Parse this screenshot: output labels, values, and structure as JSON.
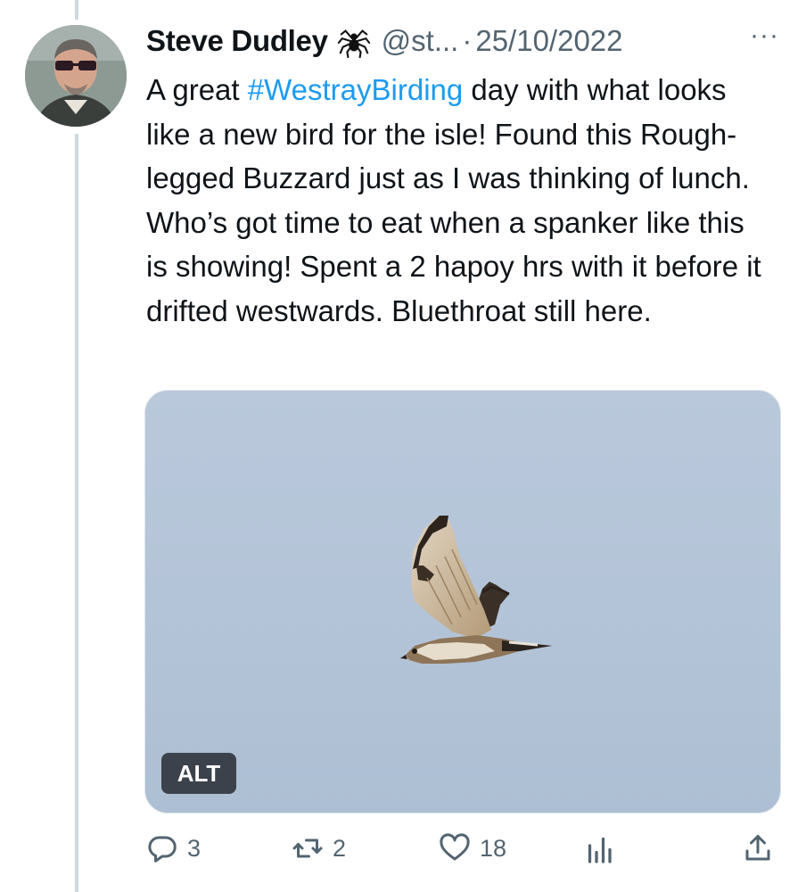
{
  "tweet": {
    "author_name": "Steve Dudley",
    "handle": "@st...",
    "separator": "·",
    "date": "25/10/2022",
    "more_label": "···",
    "text_before": "A great ",
    "hashtag": "#WestrayBirding",
    "text_after": " day with what looks like a new bird for the isle! Found this Rough-legged Buzzard just as I was thinking of lunch. Who’s got time to eat when a spanker like this is showing! Spent a 2 hapoy hrs with it before it drifted westwards. Bluethroat still here.",
    "media": {
      "alt_label": "ALT"
    }
  },
  "actions": {
    "replies": "3",
    "retweets": "2",
    "likes": "18",
    "views_icon": "bar-chart-icon",
    "share_icon": "share-icon"
  },
  "colors": {
    "hashtag": "#1d9bf0",
    "secondary_text": "#536471",
    "thread_line": "#cfd9de",
    "sky": "#b6c6da"
  }
}
